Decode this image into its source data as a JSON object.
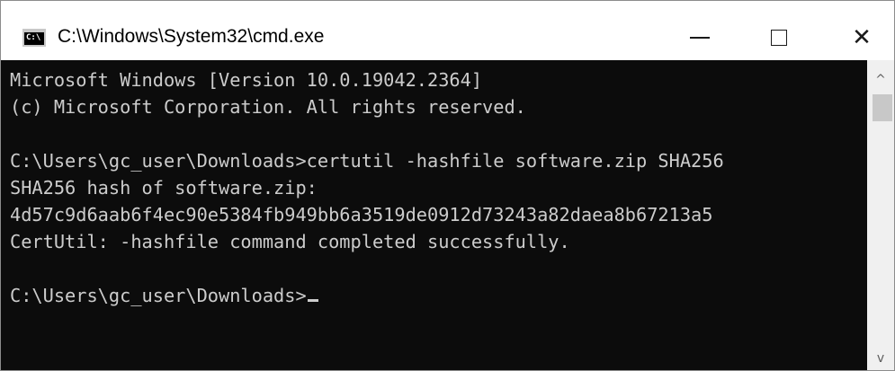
{
  "window": {
    "title": "C:\\Windows\\System32\\cmd.exe",
    "icon_label": "C:\\",
    "controls": {
      "minimize": "—",
      "maximize": "☐",
      "close": "✕"
    }
  },
  "console": {
    "lines": [
      "Microsoft Windows [Version 10.0.19042.2364]",
      "(c) Microsoft Corporation. All rights reserved.",
      "",
      "C:\\Users\\gc_user\\Downloads>certutil -hashfile software.zip SHA256",
      "SHA256 hash of software.zip:",
      "4d57c9d6aab6f4ec90e5384fb949bb6a3519de0912d73243a82daea8b67213a5",
      "CertUtil: -hashfile command completed successfully.",
      "",
      "C:\\Users\\gc_user\\Downloads>"
    ]
  },
  "scrollbar": {
    "up_arrow": "^",
    "down_arrow": "v"
  },
  "colors": {
    "console_background": "#0c0c0c",
    "console_text": "#cccccc",
    "titlebar_background": "#ffffff"
  }
}
